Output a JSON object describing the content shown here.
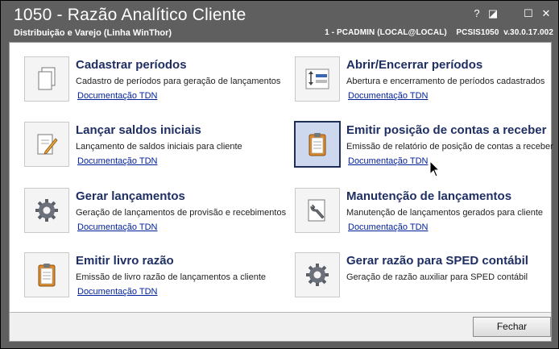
{
  "window": {
    "title": "1050 - Razão Analítico Cliente",
    "subtitle": "Distribuição e Varejo (Linha WinThor)",
    "info": "1 - PCADMIN (LOCAL@LOCAL)    PCSIS1050  v.30.0.17.002",
    "help_glyph": "?",
    "restore_glyph": "◪",
    "maximize_glyph": "☐",
    "close_glyph": "✕"
  },
  "items": [
    {
      "title": "Cadastrar períodos",
      "desc": "Cadastro de períodos para geração de lançamentos",
      "link": "Documentação TDN",
      "icon": "documents-icon"
    },
    {
      "title": "Abrir/Encerrar períodos",
      "desc": "Abertura e encerramento de períodos cadastrados",
      "link": "Documentação TDN",
      "icon": "period-toggle-icon"
    },
    {
      "title": "Lançar saldos iniciais",
      "desc": "Lançamento de saldos iniciais para cliente",
      "link": "Documentação TDN",
      "icon": "edit-document-icon"
    },
    {
      "title": "Emitir posição de contas a receber",
      "desc": "Emissão de relatório de posição de contas a receber",
      "link": "Documentação TDN",
      "icon": "clipboard-icon"
    },
    {
      "title": "Gerar lançamentos",
      "desc": "Geração de lançamentos de provisão e recebimentos",
      "link": "Documentação TDN",
      "icon": "gear-icon"
    },
    {
      "title": "Manutenção de lançamentos",
      "desc": "Manutenção de lançamentos gerados para cliente",
      "link": "Documentação TDN",
      "icon": "wrench-document-icon"
    },
    {
      "title": "Emitir livro razão",
      "desc": "Emissão de livro razão de lançamentos a cliente",
      "link": "Documentação TDN",
      "icon": "clipboard-icon"
    },
    {
      "title": "Gerar razão para SPED contábil",
      "desc": "Geração de razão auxiliar para SPED contábil",
      "link": "",
      "icon": "gear-icon"
    }
  ],
  "footer": {
    "close_label": "Fechar"
  }
}
